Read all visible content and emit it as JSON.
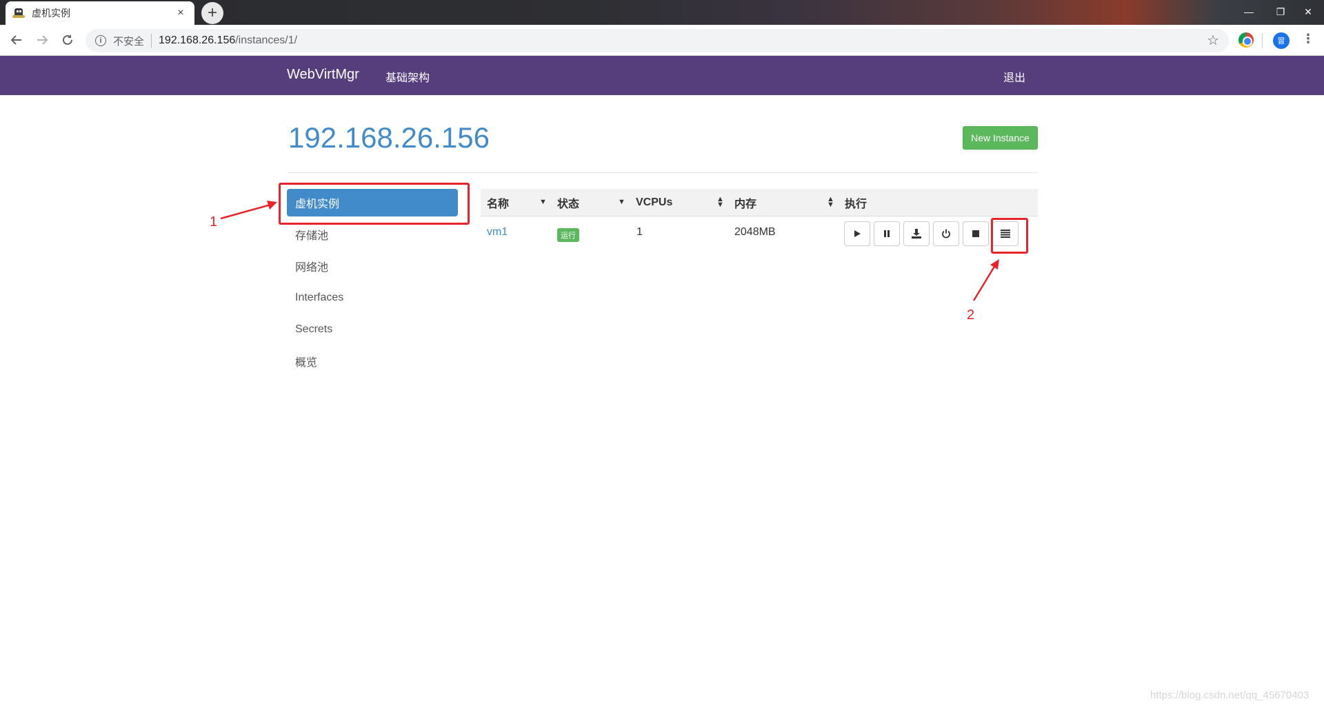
{
  "browser": {
    "tab_title": "虚机实例",
    "tab_close": "×",
    "new_tab": "+",
    "insecure_label": "不安全",
    "url_host": "192.168.26.156",
    "url_path": "/instances/1/",
    "profile_initial": "冒",
    "window_controls": [
      "—",
      "❐",
      "✕"
    ]
  },
  "navbar": {
    "brand": "WebVirtMgr",
    "infra_link": "基础架构",
    "logout_link": "退出",
    "bg_color": "#563d7c"
  },
  "page": {
    "title": "192.168.26.156",
    "new_instance_label": "New Instance"
  },
  "sidebar": {
    "items": [
      {
        "label": "虚机实例",
        "active": true
      },
      {
        "label": "存储池",
        "active": false
      },
      {
        "label": "网络池",
        "active": false
      },
      {
        "label": "Interfaces",
        "active": false
      },
      {
        "label": "Secrets",
        "active": false
      },
      {
        "label": "概览",
        "active": false
      }
    ]
  },
  "table": {
    "headers": [
      "名称",
      "状态",
      "VCPUs",
      "内存",
      "执行"
    ],
    "rows": [
      {
        "name": "vm1",
        "status": "运行",
        "vcpus": "1",
        "memory": "2048MB"
      }
    ],
    "actions": [
      "play-icon",
      "pause-icon",
      "save-icon",
      "power-icon",
      "stop-icon",
      "menu-icon"
    ]
  },
  "annotations": {
    "label_1": "1",
    "label_2": "2",
    "color": "#e8232a"
  },
  "watermark": "https://blog.csdn.net/qq_45670403"
}
